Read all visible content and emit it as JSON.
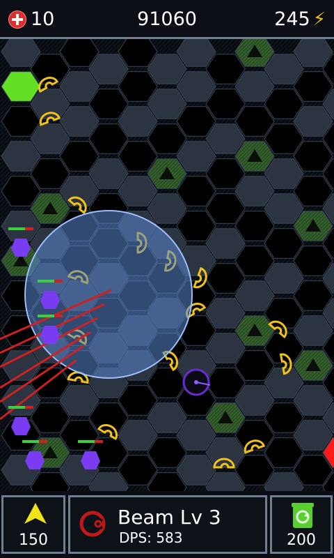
{
  "hud": {
    "lives": "10",
    "score": "91060",
    "energy": "245",
    "icons": [
      "medkit-icon",
      "lightning-icon"
    ]
  },
  "selected_tower": {
    "name": "Beam Lv 3",
    "dps": "DPS: 583"
  },
  "upgrade": {
    "cost": "150"
  },
  "sell": {
    "value": "200"
  },
  "colors": {
    "tile_dark": "#2b3440",
    "tile_empty": "#000000",
    "tower_slot": "#2f5a2a",
    "spawn": "#64e024",
    "exit": "#ff1a1a",
    "enemy_outline": "#f2c316",
    "creep": "#7a3cf0",
    "beam": "#d02020",
    "range": "#5a86d0"
  }
}
